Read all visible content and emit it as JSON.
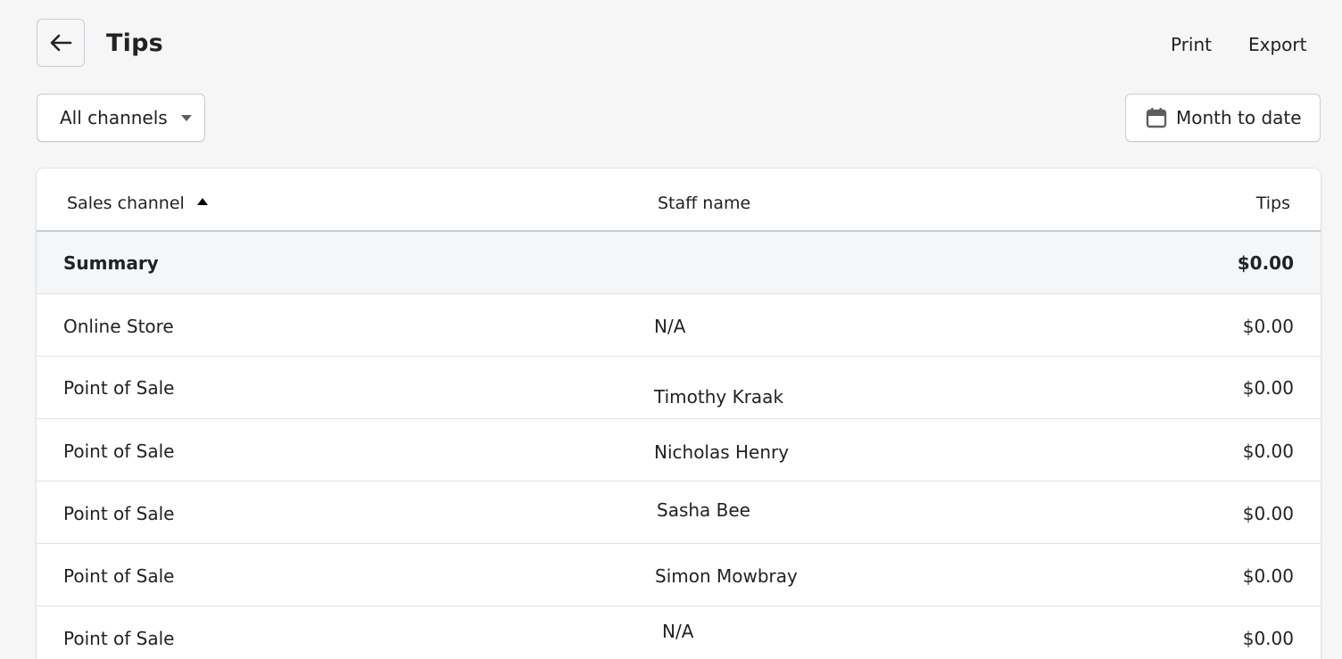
{
  "header": {
    "title": "Tips",
    "back_icon": "arrow-left-icon",
    "print_label": "Print",
    "export_label": "Export"
  },
  "filters": {
    "channels_label": "All channels",
    "date_label": "Month to date",
    "date_icon": "calendar-icon"
  },
  "table": {
    "columns": {
      "channel": "Sales channel",
      "staff": "Staff name",
      "tips": "Tips"
    },
    "sort": {
      "column": "channel",
      "direction": "ascending"
    },
    "summary": {
      "label": "Summary",
      "tips": "$0.00"
    },
    "rows": [
      {
        "channel": "Online Store",
        "staff": "N/A",
        "tips": "$0.00"
      },
      {
        "channel": "Point of Sale",
        "staff": "Timothy Kraak",
        "tips": "$0.00"
      },
      {
        "channel": "Point of Sale",
        "staff": "Nicholas Henry",
        "tips": "$0.00"
      },
      {
        "channel": "Point of Sale",
        "staff": "Sasha Bee",
        "tips": "$0.00"
      },
      {
        "channel": "Point of Sale",
        "staff": "Simon Mowbray",
        "tips": "$0.00"
      },
      {
        "channel": "Point of Sale",
        "staff": "N/A",
        "tips": "$0.00"
      }
    ]
  }
}
